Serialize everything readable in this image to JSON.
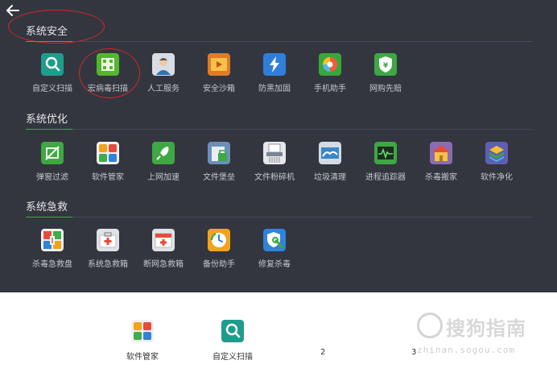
{
  "sections": [
    {
      "title": "系统安全",
      "tools": [
        {
          "label": "自定义扫描",
          "icon": "custom-scan-icon"
        },
        {
          "label": "宏病毒扫描",
          "icon": "macro-virus-scan-icon"
        },
        {
          "label": "人工服务",
          "icon": "manual-service-icon"
        },
        {
          "label": "安全沙箱",
          "icon": "security-sandbox-icon"
        },
        {
          "label": "防黑加固",
          "icon": "anti-hack-hardening-icon"
        },
        {
          "label": "手机助手",
          "icon": "phone-assistant-icon"
        },
        {
          "label": "网购先赔",
          "icon": "shopping-compensation-icon"
        }
      ]
    },
    {
      "title": "系统优化",
      "tools": [
        {
          "label": "弹窗过滤",
          "icon": "popup-filter-icon"
        },
        {
          "label": "软件管家",
          "icon": "software-manager-icon"
        },
        {
          "label": "上网加速",
          "icon": "internet-accelerate-icon"
        },
        {
          "label": "文件堡垒",
          "icon": "file-fortress-icon"
        },
        {
          "label": "文件粉碎机",
          "icon": "file-shredder-icon"
        },
        {
          "label": "垃圾清理",
          "icon": "junk-cleanup-icon"
        },
        {
          "label": "进程追踪器",
          "icon": "process-tracker-icon"
        },
        {
          "label": "杀毒搬家",
          "icon": "antivirus-move-icon"
        },
        {
          "label": "软件净化",
          "icon": "software-purify-icon"
        }
      ]
    },
    {
      "title": "系统急救",
      "tools": [
        {
          "label": "杀毒急救盘",
          "icon": "antivirus-rescue-disk-icon"
        },
        {
          "label": "系统急救箱",
          "icon": "system-first-aid-kit-icon"
        },
        {
          "label": "断网急救箱",
          "icon": "network-first-aid-kit-icon"
        },
        {
          "label": "备份助手",
          "icon": "backup-assistant-icon"
        },
        {
          "label": "修复杀毒",
          "icon": "repair-antivirus-icon"
        }
      ]
    }
  ],
  "dock": [
    {
      "label": "软件管家",
      "icon": "software-manager-icon"
    },
    {
      "label": "自定义扫描",
      "icon": "custom-scan-icon"
    }
  ],
  "pagination": [
    "2",
    "3"
  ],
  "watermark": {
    "main": "搜狗指南",
    "sub": "zhinan.sogou.com"
  },
  "colors": {
    "panel_bg": "#33363f",
    "accent_green": "#3fa94a",
    "annotation_red": "#d6262a"
  }
}
